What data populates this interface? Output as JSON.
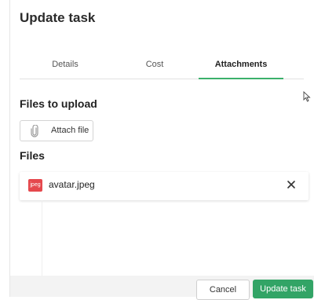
{
  "dialog": {
    "title": "Update task"
  },
  "tabs": [
    {
      "label": "Details"
    },
    {
      "label": "Cost"
    },
    {
      "label": "Attachments",
      "active": true
    }
  ],
  "upload": {
    "heading": "Files to upload",
    "attach_label": "Attach file"
  },
  "files": {
    "heading": "Files",
    "items": [
      {
        "badge": "jpeg",
        "name": "avatar.jpeg"
      }
    ]
  },
  "footer": {
    "cancel_label": "Cancel",
    "update_label": "Update task"
  },
  "colors": {
    "accent": "#32a466",
    "tab_underline": "#3bb06b",
    "file_badge": "#e5484d"
  },
  "icons": [
    "paperclip-icon",
    "close-icon",
    "mouse-pointer-icon"
  ]
}
